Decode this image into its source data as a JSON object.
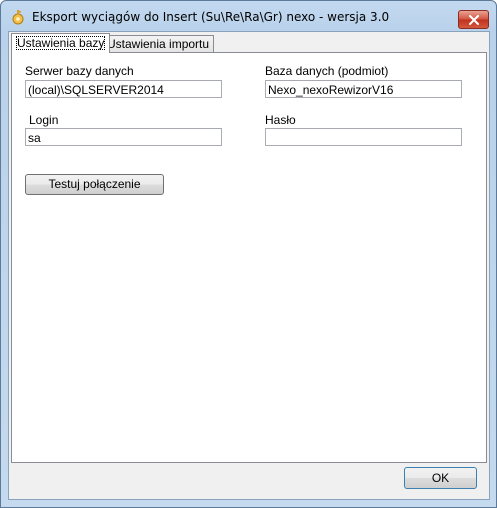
{
  "window": {
    "title": "Eksport wyciągów do Insert (Su\\Re\\Ra\\Gr) nexo - wersja 3.0",
    "icon": "key-icon"
  },
  "tabs": [
    {
      "label": "Ustawienia bazy",
      "selected": true
    },
    {
      "label": "Ustawienia importu",
      "selected": false
    }
  ],
  "form": {
    "server_label": "Serwer bazy danych",
    "server_value": "(local)\\SQLSERVER2014",
    "database_label": "Baza danych (podmiot)",
    "database_value": "Nexo_nexoRewizorV16",
    "login_label": "Login",
    "login_value": "sa",
    "password_label": "Hasło",
    "password_value": "",
    "test_button": "Testuj połączenie"
  },
  "footer": {
    "ok_button": "OK"
  },
  "colors": {
    "titlebar": "#b9d1ea",
    "close_button": "#c7412b",
    "panel": "#ffffff",
    "dialog_bg": "#f0f0f0"
  }
}
